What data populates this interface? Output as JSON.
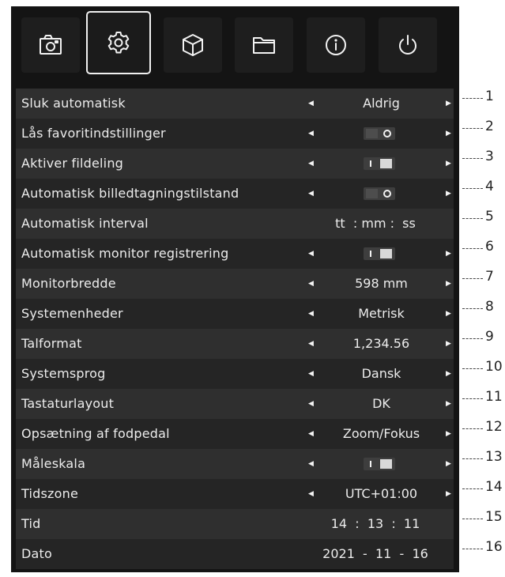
{
  "tabs": [
    {
      "icon": "camera-icon"
    },
    {
      "icon": "gear-icon",
      "active": true
    },
    {
      "icon": "cube-icon"
    },
    {
      "icon": "folder-icon"
    },
    {
      "icon": "info-icon"
    },
    {
      "icon": "power-icon"
    }
  ],
  "settings": [
    {
      "label": "Sluk automatisk",
      "type": "select",
      "value": "Aldrig",
      "callout": "1"
    },
    {
      "label": "Lås favoritindstillinger",
      "type": "toggle",
      "state": "off",
      "callout": "2"
    },
    {
      "label": "Aktiver fildeling",
      "type": "toggle",
      "state": "on",
      "callout": "3"
    },
    {
      "label": "Automatisk billedtagningstilstand",
      "type": "toggle",
      "state": "off",
      "callout": "4"
    },
    {
      "label": "Automatisk interval",
      "type": "text",
      "value": "tt  : mm :  ss",
      "callout": "5"
    },
    {
      "label": "Automatisk monitor registrering",
      "type": "toggle",
      "state": "on",
      "callout": "6"
    },
    {
      "label": "Monitorbredde",
      "type": "select",
      "value": "598 mm",
      "callout": "7"
    },
    {
      "label": "Systemenheder",
      "type": "select",
      "value": "Metrisk",
      "callout": "8"
    },
    {
      "label": "Talformat",
      "type": "select",
      "value": "1,234.56",
      "callout": "9"
    },
    {
      "label": "Systemsprog",
      "type": "select",
      "value": "Dansk",
      "callout": "10"
    },
    {
      "label": "Tastaturlayout",
      "type": "select",
      "value": "DK",
      "callout": "11"
    },
    {
      "label": "Opsætning af fodpedal",
      "type": "select",
      "value": "Zoom/Fokus",
      "callout": "12"
    },
    {
      "label": "Måleskala",
      "type": "toggle",
      "state": "on",
      "callout": "13"
    },
    {
      "label": "Tidszone",
      "type": "select",
      "value": "UTC+01:00",
      "callout": "14"
    },
    {
      "label": "Tid",
      "type": "text",
      "value": "14  :  13  :  11",
      "callout": "15"
    },
    {
      "label": "Dato",
      "type": "text",
      "value": "2021  -  11  -  16",
      "callout": "16"
    }
  ],
  "colors": {
    "panel": "#141414",
    "row_dark": "#252525",
    "row_light": "#2f2f2f",
    "text": "#ececec"
  }
}
